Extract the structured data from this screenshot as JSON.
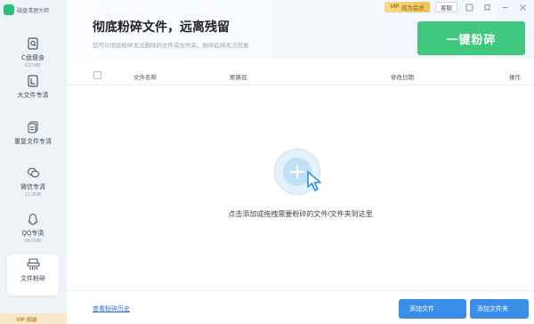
{
  "app": {
    "name": "磁盘清理大师"
  },
  "sidebar": {
    "items": [
      {
        "label": "C盘瘦身",
        "sub": "627MB",
        "icon": "disk-search-icon"
      },
      {
        "label": "大文件专清",
        "sub": "",
        "icon": "large-file-icon"
      },
      {
        "label": "重复文件专清",
        "sub": "",
        "icon": "duplicate-file-icon"
      },
      {
        "label": "微信专清",
        "sub": "12.3MB",
        "icon": "wechat-icon"
      },
      {
        "label": "QQ专清",
        "sub": "98.6MB",
        "icon": "qq-icon"
      },
      {
        "label": "文件粉碎",
        "sub": "",
        "icon": "shredder-icon"
      }
    ],
    "vip_label": "VIP 权益"
  },
  "topbar": {
    "vip_label": "成为会员",
    "vip_mark": "VIP",
    "service_label": "客服"
  },
  "header": {
    "title": "彻底粉碎文件，远离残留",
    "subtitle": "您可以彻底粉碎无法删除的文件或文件夹，粉碎后将无法恢复",
    "shred_button": "一键粉碎"
  },
  "table": {
    "columns": [
      "文件名称",
      "原路径",
      "修改日期",
      "操作"
    ]
  },
  "dropzone": {
    "hint": "点击添加或拖拽需要粉碎的文件/文件夹到这里"
  },
  "footer": {
    "history_link": "查看粉碎历史",
    "add_files": "添加文件",
    "add_folder": "添加文件夹"
  },
  "colors": {
    "accent_green": "#3fc87e",
    "accent_blue": "#3a8ee8",
    "link_blue": "#2e6fd6",
    "vip_gold": "#f2c45a"
  }
}
